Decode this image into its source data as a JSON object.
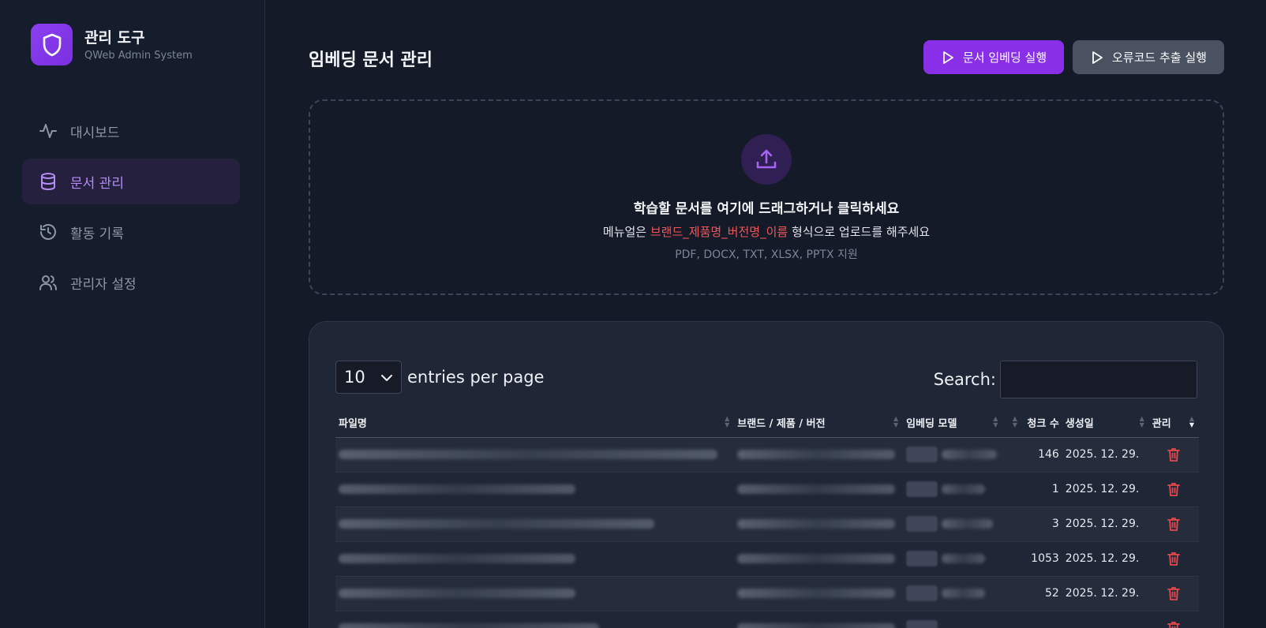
{
  "brand": {
    "title": "관리 도구",
    "subtitle": "QWeb Admin System",
    "logo_icon": "shield-icon",
    "accent": "#8b3ff0"
  },
  "nav": [
    {
      "label": "대시보드",
      "icon": "activity-icon",
      "active": false
    },
    {
      "label": "문서 관리",
      "icon": "database-icon",
      "active": true
    },
    {
      "label": "활동 기록",
      "icon": "history-icon",
      "active": false
    },
    {
      "label": "관리자 설정",
      "icon": "users-icon",
      "active": false
    }
  ],
  "header": {
    "title": "임베딩 문서 관리",
    "embed_button": "문서 임베딩 실행",
    "errorcode_button": "오류코드 추출 실행"
  },
  "dropzone": {
    "title": "학습할 문서를 여기에 드래그하거나 클릭하세요",
    "sub_prefix": "메뉴얼은 ",
    "sub_highlight": "브랜드_제품명_버전명_이름",
    "sub_suffix": " 형식으로 업로드를 해주세요",
    "formats": "PDF, DOCX, TXT, XLSX, PPTX 지원"
  },
  "table_controls": {
    "page_size": "10",
    "entries_label": "entries per page",
    "search_label": "Search:",
    "search_value": ""
  },
  "columns": [
    "파일명",
    "브랜드 / 제품 / 버전",
    "임베딩 모델",
    "",
    "청크 수",
    "생성일",
    "관리"
  ],
  "rows": [
    {
      "chunks": "146",
      "created": "2025. 12. 29."
    },
    {
      "chunks": "1",
      "created": "2025. 12. 29."
    },
    {
      "chunks": "3",
      "created": "2025. 12. 29."
    },
    {
      "chunks": "1053",
      "created": "2025. 12. 29."
    },
    {
      "chunks": "52",
      "created": "2025. 12. 29."
    },
    {
      "chunks": "",
      "created": ""
    }
  ],
  "colors": {
    "delete": "#e5484d",
    "highlight": "#f2555a",
    "primary_button": "#8a2fe8",
    "secondary_button": "#4a5262"
  }
}
